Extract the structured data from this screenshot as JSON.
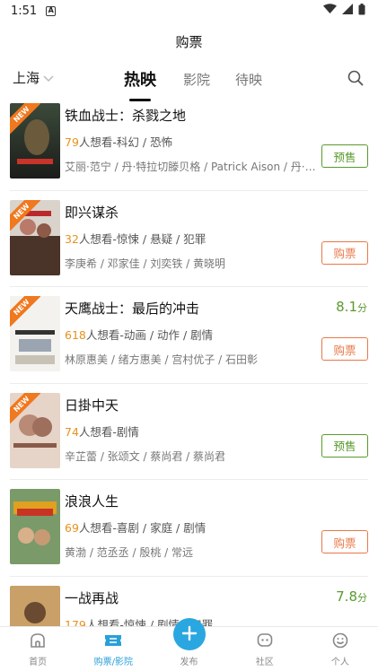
{
  "status": {
    "time": "1:51"
  },
  "header": {
    "title": "购票"
  },
  "nav": {
    "city": "上海",
    "tabs": [
      {
        "label": "热映",
        "active": true
      },
      {
        "label": "影院",
        "active": false
      },
      {
        "label": "待映",
        "active": false
      }
    ]
  },
  "movies": [
    {
      "title": "铁血战士：杀戮之地",
      "want_count": "79",
      "want_suffix": "人想看-科幻 / 恐怖",
      "cast": "艾丽·范宁 / 丹·特拉切滕贝格 / Patrick Aison / 丹·特…",
      "score": "",
      "score_unit": "",
      "button": "预售",
      "button_type": "presale",
      "is_new": true
    },
    {
      "title": "即兴谋杀",
      "want_count": "32",
      "want_suffix": "人想看-惊悚 / 悬疑 / 犯罪",
      "cast": "李庚希 / 邓家佳 / 刘奕铁 / 黄晓明",
      "score": "",
      "score_unit": "",
      "button": "购票",
      "button_type": "buy",
      "is_new": true
    },
    {
      "title": "天鹰战士：最后的冲击",
      "want_count": "618",
      "want_suffix": "人想看-动画 / 动作 / 剧情",
      "cast": "林原惠美 / 绪方惠美 / 宫村优子 / 石田彰",
      "score": "8.1",
      "score_unit": "分",
      "button": "购票",
      "button_type": "buy",
      "is_new": true
    },
    {
      "title": "日掛中天",
      "want_count": "74",
      "want_suffix": "人想看-剧情",
      "cast": "辛芷蕾 / 张颂文 / 蔡尚君 / 蔡尚君",
      "score": "",
      "score_unit": "",
      "button": "预售",
      "button_type": "presale",
      "is_new": true
    },
    {
      "title": "浪浪人生",
      "want_count": "69",
      "want_suffix": "人想看-喜剧 / 家庭 / 剧情",
      "cast": "黄渤 / 范丞丞 / 殷桃 / 常远",
      "score": "",
      "score_unit": "",
      "button": "购票",
      "button_type": "buy",
      "is_new": false
    },
    {
      "title": "一战再战",
      "want_count": "179",
      "want_suffix": "人想看-惊悚 / 剧情 / 犯罪",
      "cast": "",
      "score": "7.8",
      "score_unit": "分",
      "button": "",
      "button_type": "",
      "is_new": false
    }
  ],
  "bottom_nav": [
    {
      "label": "首页",
      "icon": "home-icon",
      "active": false
    },
    {
      "label": "购票/影院",
      "icon": "ticket-icon",
      "active": true
    },
    {
      "label": "发布",
      "icon": "plus-icon",
      "active": false
    },
    {
      "label": "社区",
      "icon": "chat-icon",
      "active": false
    },
    {
      "label": "个人",
      "icon": "smile-icon",
      "active": false
    }
  ],
  "colors": {
    "accent": "#2aa7e0",
    "score": "#5a9a2c",
    "want": "#e8911c",
    "buy": "#e87848",
    "new_badge": "#f0781e"
  }
}
